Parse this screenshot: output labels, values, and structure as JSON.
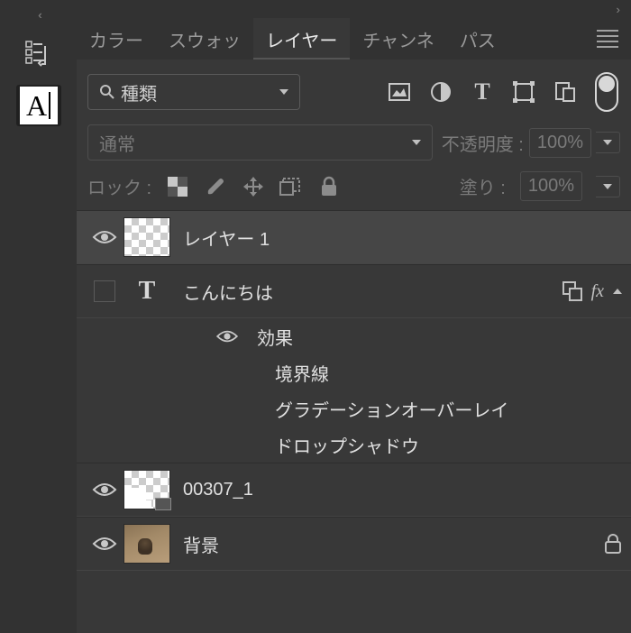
{
  "tabs": [
    "カラー",
    "スウォッ",
    "レイヤー",
    "チャンネ",
    "パス"
  ],
  "active_tab": 2,
  "filter": {
    "kind_label": "種類"
  },
  "blend": {
    "mode": "通常",
    "opacity_label": "不透明度 :",
    "opacity_value": "100%"
  },
  "lock": {
    "label": "ロック :",
    "fill_label": "塗り :",
    "fill_value": "100%"
  },
  "layers": [
    {
      "name": "レイヤー 1",
      "visible": true,
      "type": "pixel",
      "selected": true
    },
    {
      "name": "こんにちは",
      "visible": false,
      "type": "text",
      "fx": true,
      "fx_open": true,
      "effects_label": "効果",
      "effects": [
        "境界線",
        "グラデーションオーバーレイ",
        "ドロップシャドウ"
      ]
    },
    {
      "name": "00307_1",
      "visible": true,
      "type": "smart"
    },
    {
      "name": "背景",
      "visible": true,
      "type": "image",
      "locked": true
    }
  ]
}
